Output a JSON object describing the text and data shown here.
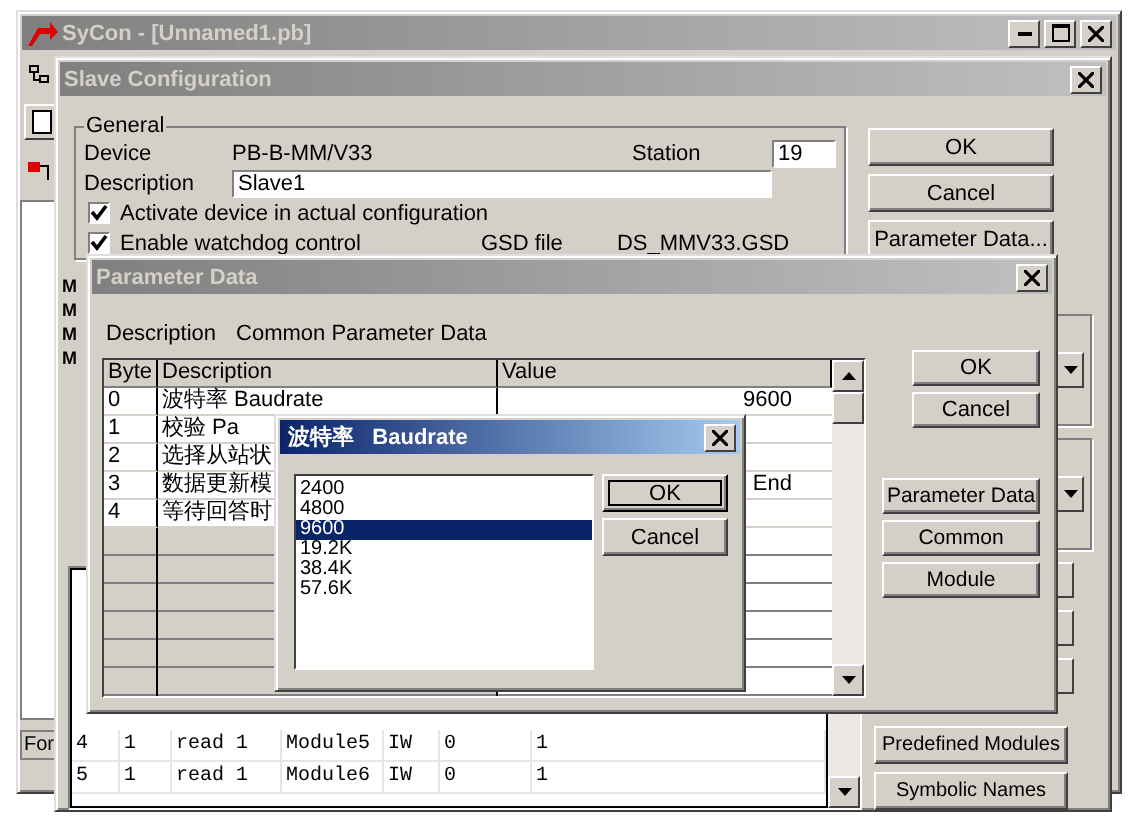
{
  "main_window": {
    "title": "SyCon - [Unnamed1.pb]",
    "status_tab": "For"
  },
  "slave_configuration": {
    "title": "Slave Configuration",
    "general": {
      "legend": "General",
      "device_label": "Device",
      "device": "PB-B-MM/V33",
      "station_label": "Station",
      "station": "19",
      "description_label": "Description",
      "description": "Slave1",
      "checkboxes": [
        {
          "label": "Activate device in actual configuration",
          "checked": true
        },
        {
          "label": "Enable watchdog control",
          "checked": true
        }
      ],
      "gsd_label": "GSD file",
      "gsd_file": "DS_MMV33.GSD"
    },
    "buttons": [
      "OK",
      "Cancel",
      "Parameter Data..."
    ],
    "side_labels": [
      "M",
      "M",
      "M",
      "M"
    ],
    "module_table": {
      "rows": [
        [
          "4",
          "1",
          "read 1",
          "Module5",
          "IW",
          "0",
          "1"
        ],
        [
          "5",
          "1",
          "read 1",
          "Module6",
          "IW",
          "0",
          "1"
        ]
      ]
    },
    "side_buttons": [
      "Predefined Modules",
      "Symbolic Names"
    ]
  },
  "parameter_data": {
    "title": "Parameter Data",
    "description_label": "Description",
    "description": "Common Parameter Data",
    "table": {
      "columns": [
        "Byte",
        "Description",
        "Value"
      ],
      "rows": [
        {
          "byte": "0",
          "description": "波特率      Baudrate",
          "value": "9600"
        },
        {
          "byte": "1",
          "description": "校验        Pa",
          "value": ""
        },
        {
          "byte": "2",
          "description": "选择从站状",
          "value": ""
        },
        {
          "byte": "3",
          "description": "数据更新模",
          "value": "End"
        },
        {
          "byte": "4",
          "description": "等待回答时",
          "value": ""
        }
      ]
    },
    "buttons": [
      "OK",
      "Cancel"
    ],
    "side_buttons": [
      "Parameter Data",
      "Common",
      "Module"
    ]
  },
  "baudrate_dialog": {
    "title": "波特率   Baudrate",
    "options": [
      {
        "label": "2400",
        "selected": false
      },
      {
        "label": "4800",
        "selected": false
      },
      {
        "label": "9600",
        "selected": true
      },
      {
        "label": "19.2K",
        "selected": false
      },
      {
        "label": "38.4K",
        "selected": false
      },
      {
        "label": "57.6K",
        "selected": false
      }
    ],
    "buttons": [
      "OK",
      "Cancel"
    ]
  }
}
